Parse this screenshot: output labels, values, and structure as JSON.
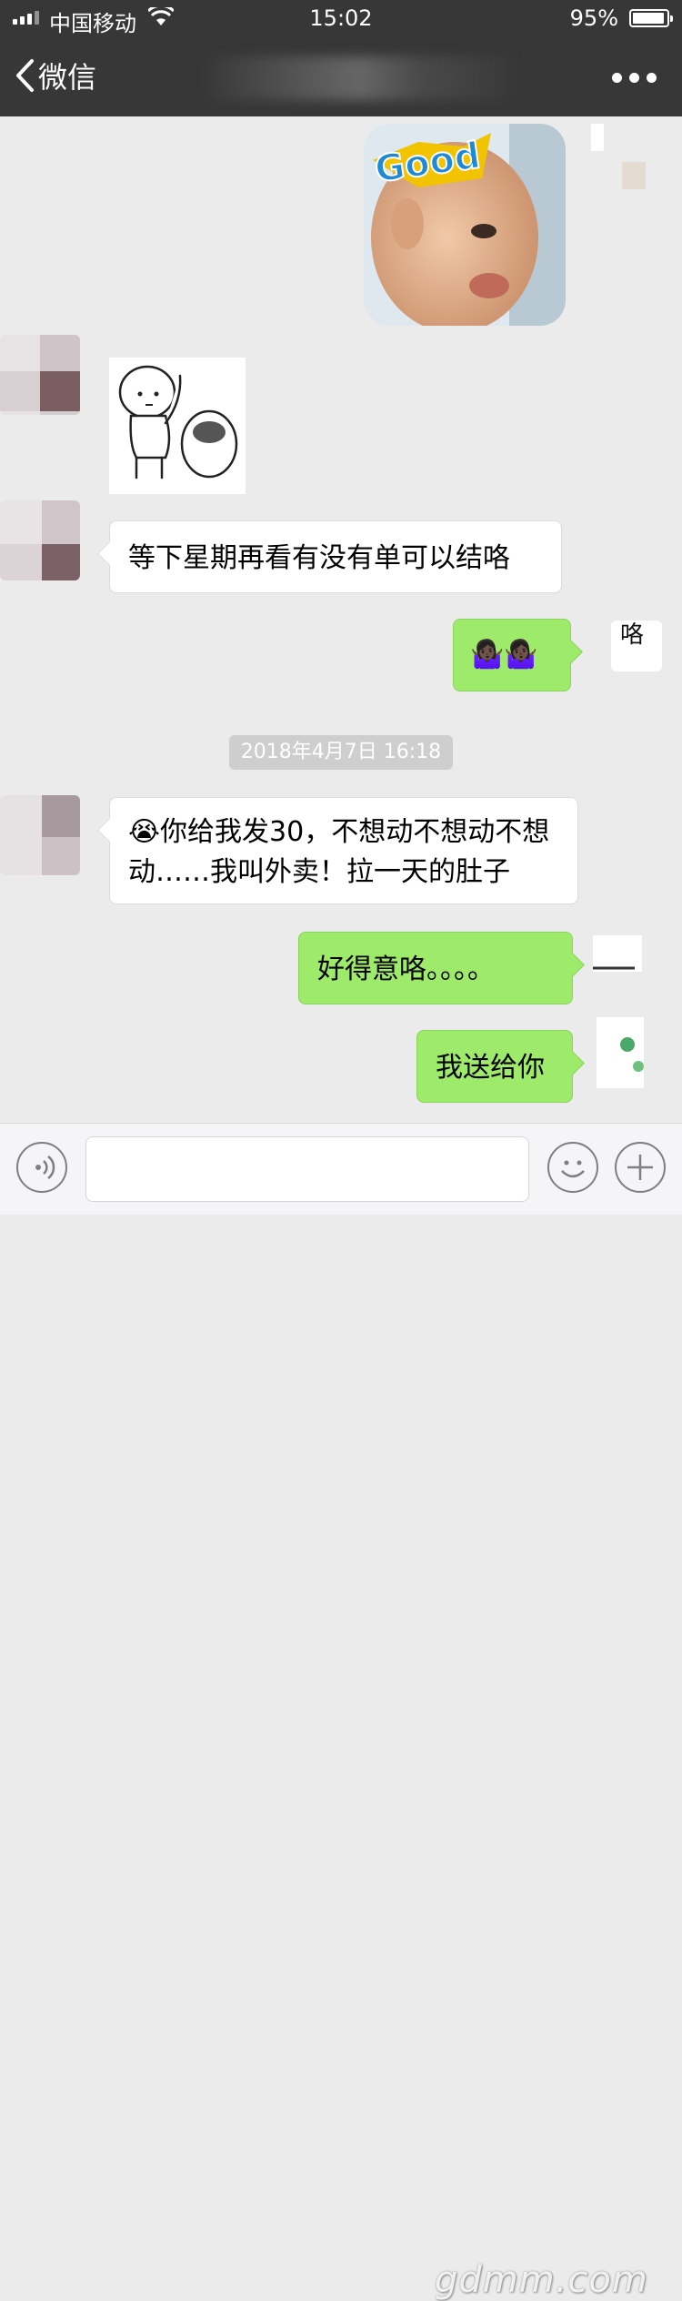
{
  "status_bar": {
    "carrier": "中国移动",
    "time": "15:02",
    "battery_percent": "95%",
    "battery_level": 0.95
  },
  "nav": {
    "back_label": "微信",
    "more_icon": "more-icon"
  },
  "messages": [
    {
      "id": "m1",
      "direction": "outgoing",
      "type": "sticker",
      "sticker_text": "Good"
    },
    {
      "id": "m2",
      "direction": "incoming",
      "type": "sticker"
    },
    {
      "id": "m3",
      "direction": "incoming",
      "type": "text",
      "text": "等下星期再看有没有单可以结咯"
    },
    {
      "id": "m4",
      "direction": "outgoing",
      "type": "emoji",
      "text": "🤷🏿‍♀️🤷🏿‍♀️"
    },
    {
      "id": "m5",
      "direction": "incoming",
      "type": "text",
      "text": "😭你给我发30，不想动不想动不想动……我叫外卖！拉一天的肚子"
    },
    {
      "id": "m6",
      "direction": "outgoing",
      "type": "text",
      "text": "好得意咯。。。。"
    },
    {
      "id": "m7",
      "direction": "outgoing",
      "type": "text",
      "text": "我送给你"
    }
  ],
  "timestamp": "2018年4月7日 16:18",
  "input_bar": {
    "placeholder": "",
    "voice_icon": "voice-icon",
    "emoji_icon": "emoji-icon",
    "plus_icon": "plus-icon"
  },
  "watermark": "gdmm.com",
  "colors": {
    "nav_bg": "#373737",
    "chat_bg": "#ebebeb",
    "outgoing_bubble": "#9eea6a",
    "incoming_bubble": "#ffffff",
    "timestamp_bg": "#cecece"
  }
}
